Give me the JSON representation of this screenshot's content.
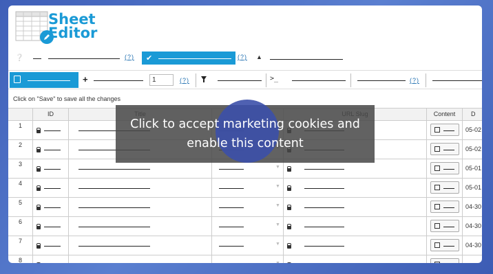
{
  "app": {
    "logo_line1": "Sheet",
    "logo_line2": "Editor"
  },
  "toolbar1": {
    "help_link_1": "(?)",
    "help_link_2": "(?)"
  },
  "toolbar2": {
    "rows_value": "1",
    "help_link_1": "(?)",
    "help_link_2": "(?)"
  },
  "hint": "Click on \"Save\" to save all the changes",
  "table": {
    "columns": [
      "ID",
      "Title",
      "URL Slug",
      "Content",
      "D"
    ],
    "rows": [
      {
        "num": "1",
        "date": "05-02"
      },
      {
        "num": "2",
        "date": "05-02"
      },
      {
        "num": "3",
        "date": "05-01"
      },
      {
        "num": "4",
        "date": "05-01"
      },
      {
        "num": "5",
        "date": "04-30"
      },
      {
        "num": "6",
        "date": "04-30"
      },
      {
        "num": "7",
        "date": "04-30"
      },
      {
        "num": "8",
        "date": ""
      }
    ]
  },
  "overlay": {
    "line1": "Click to accept marketing cookies and",
    "line2": "enable this content"
  },
  "colors": {
    "accent": "#1a9ad6",
    "background": "#4a6cc4",
    "overlay": "#464646"
  }
}
